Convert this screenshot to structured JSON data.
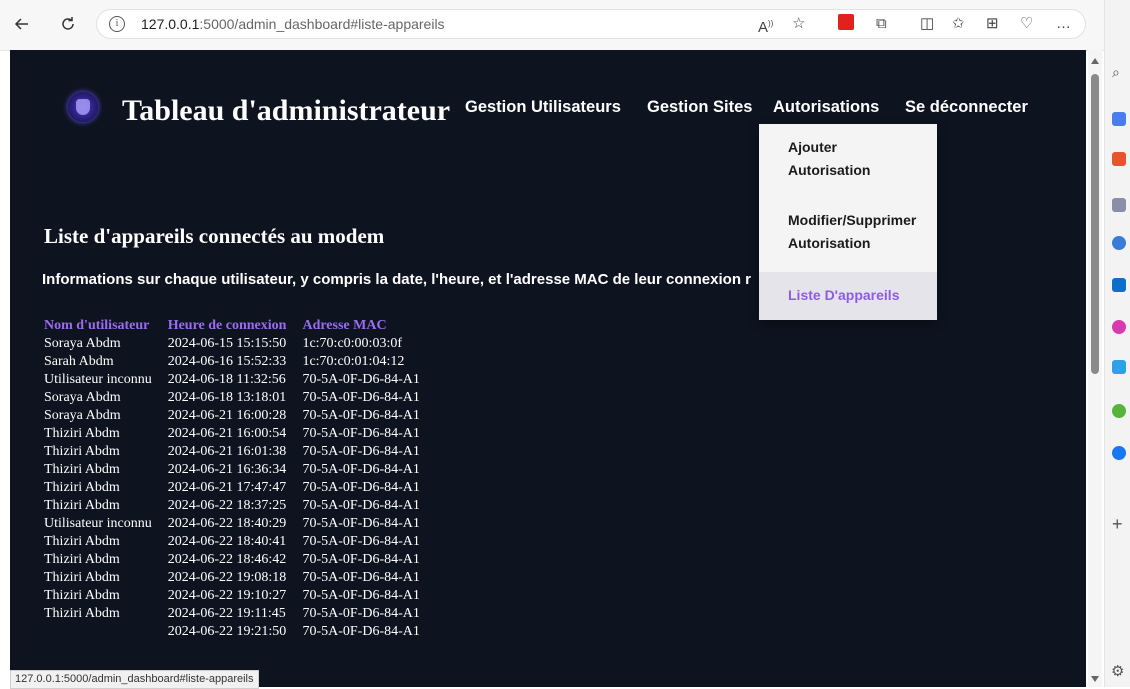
{
  "browser": {
    "url_host": "127.0.0.1",
    "url_path": ":5000/admin_dashboard#liste-appareils",
    "status_url": "127.0.0.1:5000/admin_dashboard#liste-appareils"
  },
  "header": {
    "title": "Tableau d'administrateur",
    "nav": {
      "users": "Gestion Utilisateurs",
      "sites": "Gestion Sites",
      "auth": "Autorisations",
      "logout": "Se déconnecter"
    }
  },
  "dropdown": {
    "add_line1": "Ajouter",
    "add_line2": "Autorisation",
    "edit_line1": "Modifier/Supprimer",
    "edit_line2": "Autorisation",
    "devices": "Liste D'appareils"
  },
  "section": {
    "title": "Liste d'appareils connectés au modem",
    "subtitle": "Informations sur chaque utilisateur, y compris la date, l'heure, et l'adresse MAC de leur connexion r"
  },
  "table": {
    "headers": [
      "Nom d'utilisateur",
      "Heure de connexion",
      "Adresse MAC"
    ],
    "rows": [
      [
        "Soraya Abdm",
        "2024-06-15 15:15:50",
        "1c:70:c0:00:03:0f"
      ],
      [
        "Sarah Abdm",
        "2024-06-16 15:52:33",
        "1c:70:c0:01:04:12"
      ],
      [
        "Utilisateur inconnu",
        "2024-06-18 11:32:56",
        "70-5A-0F-D6-84-A1"
      ],
      [
        "Soraya Abdm",
        "2024-06-18 13:18:01",
        "70-5A-0F-D6-84-A1"
      ],
      [
        "Soraya Abdm",
        "2024-06-21 16:00:28",
        "70-5A-0F-D6-84-A1"
      ],
      [
        "Thiziri Abdm",
        "2024-06-21 16:00:54",
        "70-5A-0F-D6-84-A1"
      ],
      [
        "Thiziri Abdm",
        "2024-06-21 16:01:38",
        "70-5A-0F-D6-84-A1"
      ],
      [
        "Thiziri Abdm",
        "2024-06-21 16:36:34",
        "70-5A-0F-D6-84-A1"
      ],
      [
        "Thiziri Abdm",
        "2024-06-21 17:47:47",
        "70-5A-0F-D6-84-A1"
      ],
      [
        "Thiziri Abdm",
        "2024-06-22 18:37:25",
        "70-5A-0F-D6-84-A1"
      ],
      [
        "Utilisateur inconnu",
        "2024-06-22 18:40:29",
        "70-5A-0F-D6-84-A1"
      ],
      [
        "Thiziri Abdm",
        "2024-06-22 18:40:41",
        "70-5A-0F-D6-84-A1"
      ],
      [
        "Thiziri Abdm",
        "2024-06-22 18:46:42",
        "70-5A-0F-D6-84-A1"
      ],
      [
        "Thiziri Abdm",
        "2024-06-22 19:08:18",
        "70-5A-0F-D6-84-A1"
      ],
      [
        "Thiziri Abdm",
        "2024-06-22 19:10:27",
        "70-5A-0F-D6-84-A1"
      ],
      [
        "Thiziri Abdm",
        "2024-06-22 19:11:45",
        "70-5A-0F-D6-84-A1"
      ],
      [
        "",
        "2024-06-22 19:21:50",
        "70-5A-0F-D6-84-A1"
      ]
    ]
  },
  "colors": {
    "page_bg": "#0d1420",
    "accent": "#9b6cf0",
    "dropdown_bg": "#f4f4f4"
  },
  "icons": [
    "back-icon",
    "refresh-icon",
    "info-icon",
    "read-aloud-icon",
    "favorite-star-icon",
    "extension-icon",
    "extensions-puzzle-icon",
    "split-screen-icon",
    "favorites-icon",
    "collections-icon",
    "browser-essentials-icon",
    "more-icon",
    "copilot-icon",
    "search-icon",
    "plus-icon",
    "settings-icon"
  ]
}
